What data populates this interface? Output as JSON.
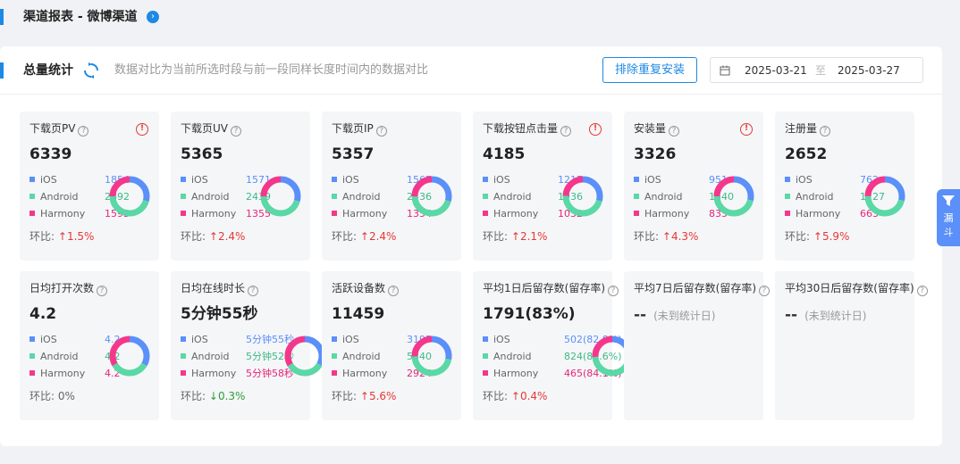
{
  "page": {
    "title": "渠道报表 - 微博渠道",
    "info_icon": "info-icon"
  },
  "panel": {
    "title": "总量统计",
    "description": "数据对比为当前所选时段与前一段同样长度时间内的数据对比",
    "dedup_button": "排除重复安装",
    "date_start": "2025-03-21",
    "date_sep": "至",
    "date_end": "2025-03-27"
  },
  "colors": {
    "ios": "#5b8ff9",
    "android": "#5ad8a6",
    "harmony": "#f4378b",
    "up": "#e53935",
    "down": "#2e9d3a",
    "accent": "#1e88e5"
  },
  "platform_labels": {
    "ios": "iOS",
    "android": "Android",
    "harmony": "Harmony"
  },
  "ratio_label": "环比:",
  "cards": [
    {
      "name": "下载页PV",
      "warn": true,
      "value": "6339",
      "ios": "1854",
      "android": "2892",
      "harmony": "1593",
      "share": [
        1854,
        2892,
        1593
      ],
      "trend": "up",
      "ratio": "1.5%"
    },
    {
      "name": "下载页UV",
      "warn": false,
      "value": "5365",
      "ios": "1571",
      "android": "2439",
      "harmony": "1355",
      "share": [
        1571,
        2439,
        1355
      ],
      "trend": "up",
      "ratio": "2.4%"
    },
    {
      "name": "下载页IP",
      "warn": false,
      "value": "5357",
      "ios": "1567",
      "android": "2436",
      "harmony": "1354",
      "share": [
        1567,
        2436,
        1354
      ],
      "trend": "up",
      "ratio": "2.4%"
    },
    {
      "name": "下载按钮点击量",
      "warn": true,
      "value": "4185",
      "ios": "1217",
      "android": "1936",
      "harmony": "1032",
      "share": [
        1217,
        1936,
        1032
      ],
      "trend": "up",
      "ratio": "2.1%"
    },
    {
      "name": "安装量",
      "warn": true,
      "value": "3326",
      "ios": "951",
      "android": "1540",
      "harmony": "835",
      "share": [
        951,
        1540,
        835
      ],
      "trend": "up",
      "ratio": "4.3%"
    },
    {
      "name": "注册量",
      "warn": false,
      "value": "2652",
      "ios": "762",
      "android": "1227",
      "harmony": "663",
      "share": [
        762,
        1227,
        663
      ],
      "trend": "up",
      "ratio": "5.9%"
    },
    {
      "name": "日均打开次数",
      "warn": false,
      "value": "4.2",
      "ios": "4.2",
      "android": "4.2",
      "harmony": "4.2",
      "share": [
        1,
        1,
        1
      ],
      "trend": "flat",
      "ratio": "0%"
    },
    {
      "name": "日均在线时长",
      "warn": false,
      "value": "5分钟55秒",
      "ios": "5分钟55秒",
      "android": "5分钟52秒",
      "harmony": "5分钟58秒",
      "share": [
        355,
        352,
        358
      ],
      "trend": "down",
      "ratio": "0.3%"
    },
    {
      "name": "活跃设备数",
      "warn": false,
      "value": "11459",
      "ios": "3195",
      "android": "5340",
      "harmony": "2924",
      "share": [
        3195,
        5340,
        2924
      ],
      "trend": "up",
      "ratio": "5.6%"
    },
    {
      "name": "平均1日后留存数(留存率)",
      "warn": false,
      "value": "1791(83%)",
      "ios": "502(82.8%)",
      "android": "824(82.6%)",
      "harmony": "465(84.1%)",
      "share": [
        502,
        824,
        465
      ],
      "trend": "up",
      "ratio": "0.4%"
    },
    {
      "name": "平均7日后留存数(留存率)",
      "na": true,
      "value": "--",
      "na_text": "(未到统计日)"
    },
    {
      "name": "平均30日后留存数(留存率)",
      "na": true,
      "value": "--",
      "na_text": "(未到统计日)"
    }
  ],
  "float_tab": {
    "icon": "funnel-icon",
    "line1": "漏",
    "line2": "斗"
  }
}
